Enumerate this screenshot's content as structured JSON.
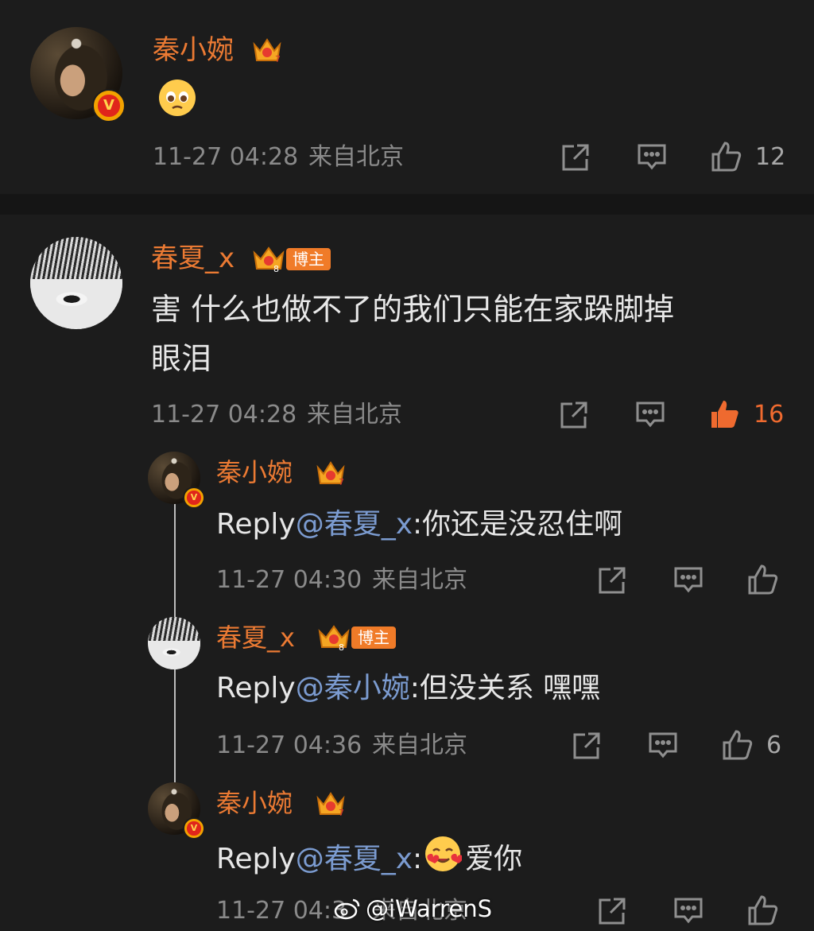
{
  "comments": [
    {
      "user": "秦小婉",
      "level": "7",
      "time": "11-27 04:28",
      "location": "来自北京",
      "likes": "12",
      "emoji": "pleading-face"
    },
    {
      "user": "春夏_x",
      "level": "8",
      "tag": "博主",
      "text_line1": "害 什么也做不了的我们只能在家跺脚掉",
      "text_line2": "眼泪",
      "time": "11-27 04:28",
      "location": "来自北京",
      "likes": "16",
      "liked": true
    }
  ],
  "replies": [
    {
      "user": "秦小婉",
      "level": "7",
      "prefix": "Reply",
      "mention": "@春夏_x",
      "text": ":你还是没忍住啊",
      "time": "11-27 04:30",
      "location": "来自北京",
      "likes": ""
    },
    {
      "user": "春夏_x",
      "level": "8",
      "tag": "博主",
      "prefix": "Reply",
      "mention": "@秦小婉",
      "text": ":但没关系 嘿嘿",
      "time": "11-27 04:36",
      "location": "来自北京",
      "likes": "6"
    },
    {
      "user": "秦小婉",
      "level": "7",
      "prefix": "Reply",
      "mention": "@春夏_x",
      "text_before_emoji": ":",
      "emoji": "smiling-face-with-hearts",
      "text": "爱你",
      "time": "11-27 04:3",
      "location": "来自北京",
      "likes": ""
    }
  ],
  "watermark": "@iWarrenS",
  "colors": {
    "background": "#1c1c1c",
    "username": "#eb7a33",
    "mention": "#7b9bd0",
    "meta": "#8a8a8a",
    "liked": "#ef6a2f",
    "tag_bg": "#f07b28"
  }
}
